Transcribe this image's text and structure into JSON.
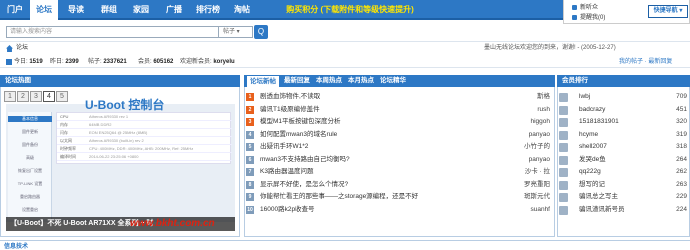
{
  "nav": {
    "items": [
      "门户",
      "论坛",
      "导读",
      "群组",
      "家园",
      "广播",
      "排行榜",
      "淘帖"
    ],
    "promo": "购买积分 (下载附件和等级快速提升)",
    "user_menu": [
      "新听众",
      "提醒我(0)"
    ],
    "quick_nav": "快捷导航"
  },
  "search": {
    "placeholder": "请输入搜索内容",
    "type": "帖子",
    "button": "Q"
  },
  "breadcrumb": {
    "text": "论坛",
    "notice": "墨山无线论坛欢迎您的到来，谢谢! - (2005-12-27)"
  },
  "stats": {
    "today_label": "今日:",
    "today": "1519",
    "yesterday_label": "昨日:",
    "yesterday": "2399",
    "posts_label": "帖子:",
    "posts": "2337621",
    "members_label": "会员:",
    "members": "605162",
    "welcome_label": "欢迎新会员:",
    "newest": "koryelu",
    "links": "我的帖子 · 最新回复"
  },
  "panel1": {
    "title": "论坛热图",
    "pages": [
      "1",
      "2",
      "3",
      "4",
      "5"
    ],
    "active_page": "4",
    "slide_title": "U-Boot 控制台",
    "side_items": [
      "基本信息",
      "固件更新",
      "固件备份",
      "高级",
      "恢复出厂设置",
      "TP-LINK 设置",
      "重启路由器",
      "设置重启"
    ],
    "info_rows": [
      [
        "CPU",
        "Atheros AR9330 rev 1"
      ],
      [
        "内存",
        "64MB DDR2"
      ],
      [
        "闪存",
        "EON EN25Q64 @ 25MHz (8MB)"
      ],
      [
        "以太网",
        "Atheros AR9330 (built-in) rev 2"
      ],
      [
        "时钟频率",
        "CPU: 400MHz, DDR: 400MHz, AHB: 200MHz, Ref: 25MHz"
      ],
      [
        "编译时间",
        "2014-06-22 23:25:06 +0800"
      ]
    ],
    "caption": "【U-Boot】不死 U-Boot AR71XX 全系列 + 时",
    "watermark": "www.bkht.com.cn"
  },
  "panel2": {
    "tabs": [
      "论坛新帖",
      "最新回复",
      "本周热点",
      "本月热点",
      "论坛精华"
    ],
    "rows": [
      {
        "n": "1",
        "title": "剧透血饰物件,不读取",
        "author": "斯格"
      },
      {
        "n": "2",
        "title": "骗讯T1级原编修盖件",
        "author": "rush"
      },
      {
        "n": "3",
        "title": "模型M1平板按键包深度分析",
        "author": "higgoh"
      },
      {
        "n": "4",
        "title": "如何配置mwan3的域名rule",
        "author": "panyao"
      },
      {
        "n": "5",
        "title": "出疑讯手环W1*2",
        "author": "小竹子的"
      },
      {
        "n": "6",
        "title": "mwan3不支持路由自己均衡吗?",
        "author": "panyao"
      },
      {
        "n": "7",
        "title": "K3路由器温度问题",
        "author": "沙卡 · 拉"
      },
      {
        "n": "8",
        "title": "显示屏不好使，是怎么个情况?",
        "author": "罗亮重阳"
      },
      {
        "n": "9",
        "title": "你能帮忙看王的那些事——之storage源编程，还是不好",
        "author": "斑斯元代"
      },
      {
        "n": "10",
        "title": "16000路k2p收查号",
        "author": "suanhf"
      }
    ]
  },
  "panel3": {
    "title": "会员排行",
    "rows": [
      {
        "name": "lwbj",
        "score": "709"
      },
      {
        "name": "badcrazy",
        "score": "451"
      },
      {
        "name": "15181831901",
        "score": "320"
      },
      {
        "name": "hcyme",
        "score": "319"
      },
      {
        "name": "shell2007",
        "score": "318"
      },
      {
        "name": "发哭de鱼",
        "score": "264"
      },
      {
        "name": "qq222g",
        "score": "262"
      },
      {
        "name": "想写的记",
        "score": "263"
      },
      {
        "name": "骗讯总之写主",
        "score": "229"
      },
      {
        "name": "骗讯渣讯新号员",
        "score": "224"
      }
    ]
  },
  "footer_label": "信息技术",
  "colors": {
    "accent": "#2d78c5",
    "num_top": "#e8601c",
    "num_rest": "#7f9cba",
    "promo": "#ffe600"
  }
}
